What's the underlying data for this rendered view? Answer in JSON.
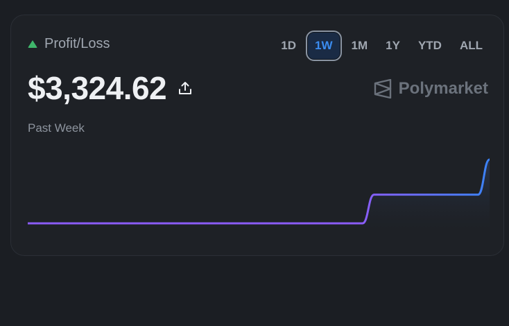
{
  "widget": {
    "label": "Profit/Loss",
    "trend_icon": "triangle-up-icon",
    "trend_color": "#3fb66b",
    "amount": "$3,324.62",
    "share_icon": "upload-share-icon",
    "period_label": "Past Week",
    "brand": "Polymarket",
    "brand_icon": "polymarket-logo-icon"
  },
  "ranges": [
    {
      "label": "1D",
      "active": false
    },
    {
      "label": "1W",
      "active": true
    },
    {
      "label": "1M",
      "active": false
    },
    {
      "label": "1Y",
      "active": false
    },
    {
      "label": "YTD",
      "active": false
    },
    {
      "label": "ALL",
      "active": false
    }
  ],
  "colors": {
    "accent": "#3b8cf0",
    "line_start": "#8b5cf6",
    "line_end": "#3b82f6"
  },
  "chart_data": {
    "type": "line",
    "title": "",
    "xlabel": "",
    "ylabel": "",
    "series": [
      {
        "values": [
          0,
          0,
          0,
          0,
          0,
          0,
          0,
          0,
          0,
          0,
          0,
          0,
          0,
          0,
          0,
          0,
          0,
          0,
          0,
          0,
          0,
          0,
          0,
          0,
          0,
          0,
          0,
          0,
          0,
          0,
          0.45,
          0.45,
          0.45,
          0.45,
          0.45,
          0.45,
          0.45,
          0.45,
          0.45,
          0.45,
          1.0
        ]
      }
    ],
    "grid": false,
    "legend": "none"
  }
}
